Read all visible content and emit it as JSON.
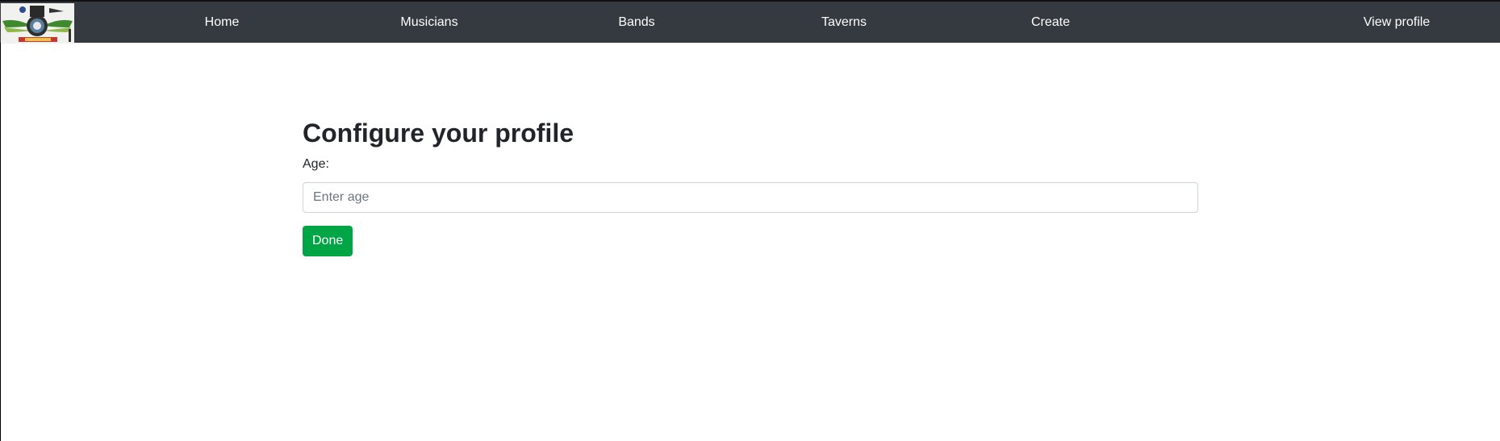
{
  "nav": {
    "logo_alt": "logo",
    "items": [
      {
        "label": "Home"
      },
      {
        "label": "Musicians"
      },
      {
        "label": "Bands"
      },
      {
        "label": "Taverns"
      },
      {
        "label": "Create"
      },
      {
        "label": "View profile"
      }
    ]
  },
  "main": {
    "title": "Configure your profile",
    "age_label": "Age:",
    "age_placeholder": "Enter age",
    "age_value": "",
    "done_label": "Done"
  },
  "colors": {
    "navbar": "#343a40",
    "nav_text": "#ffffff",
    "done_button": "#00a645",
    "title_text": "#212529"
  }
}
